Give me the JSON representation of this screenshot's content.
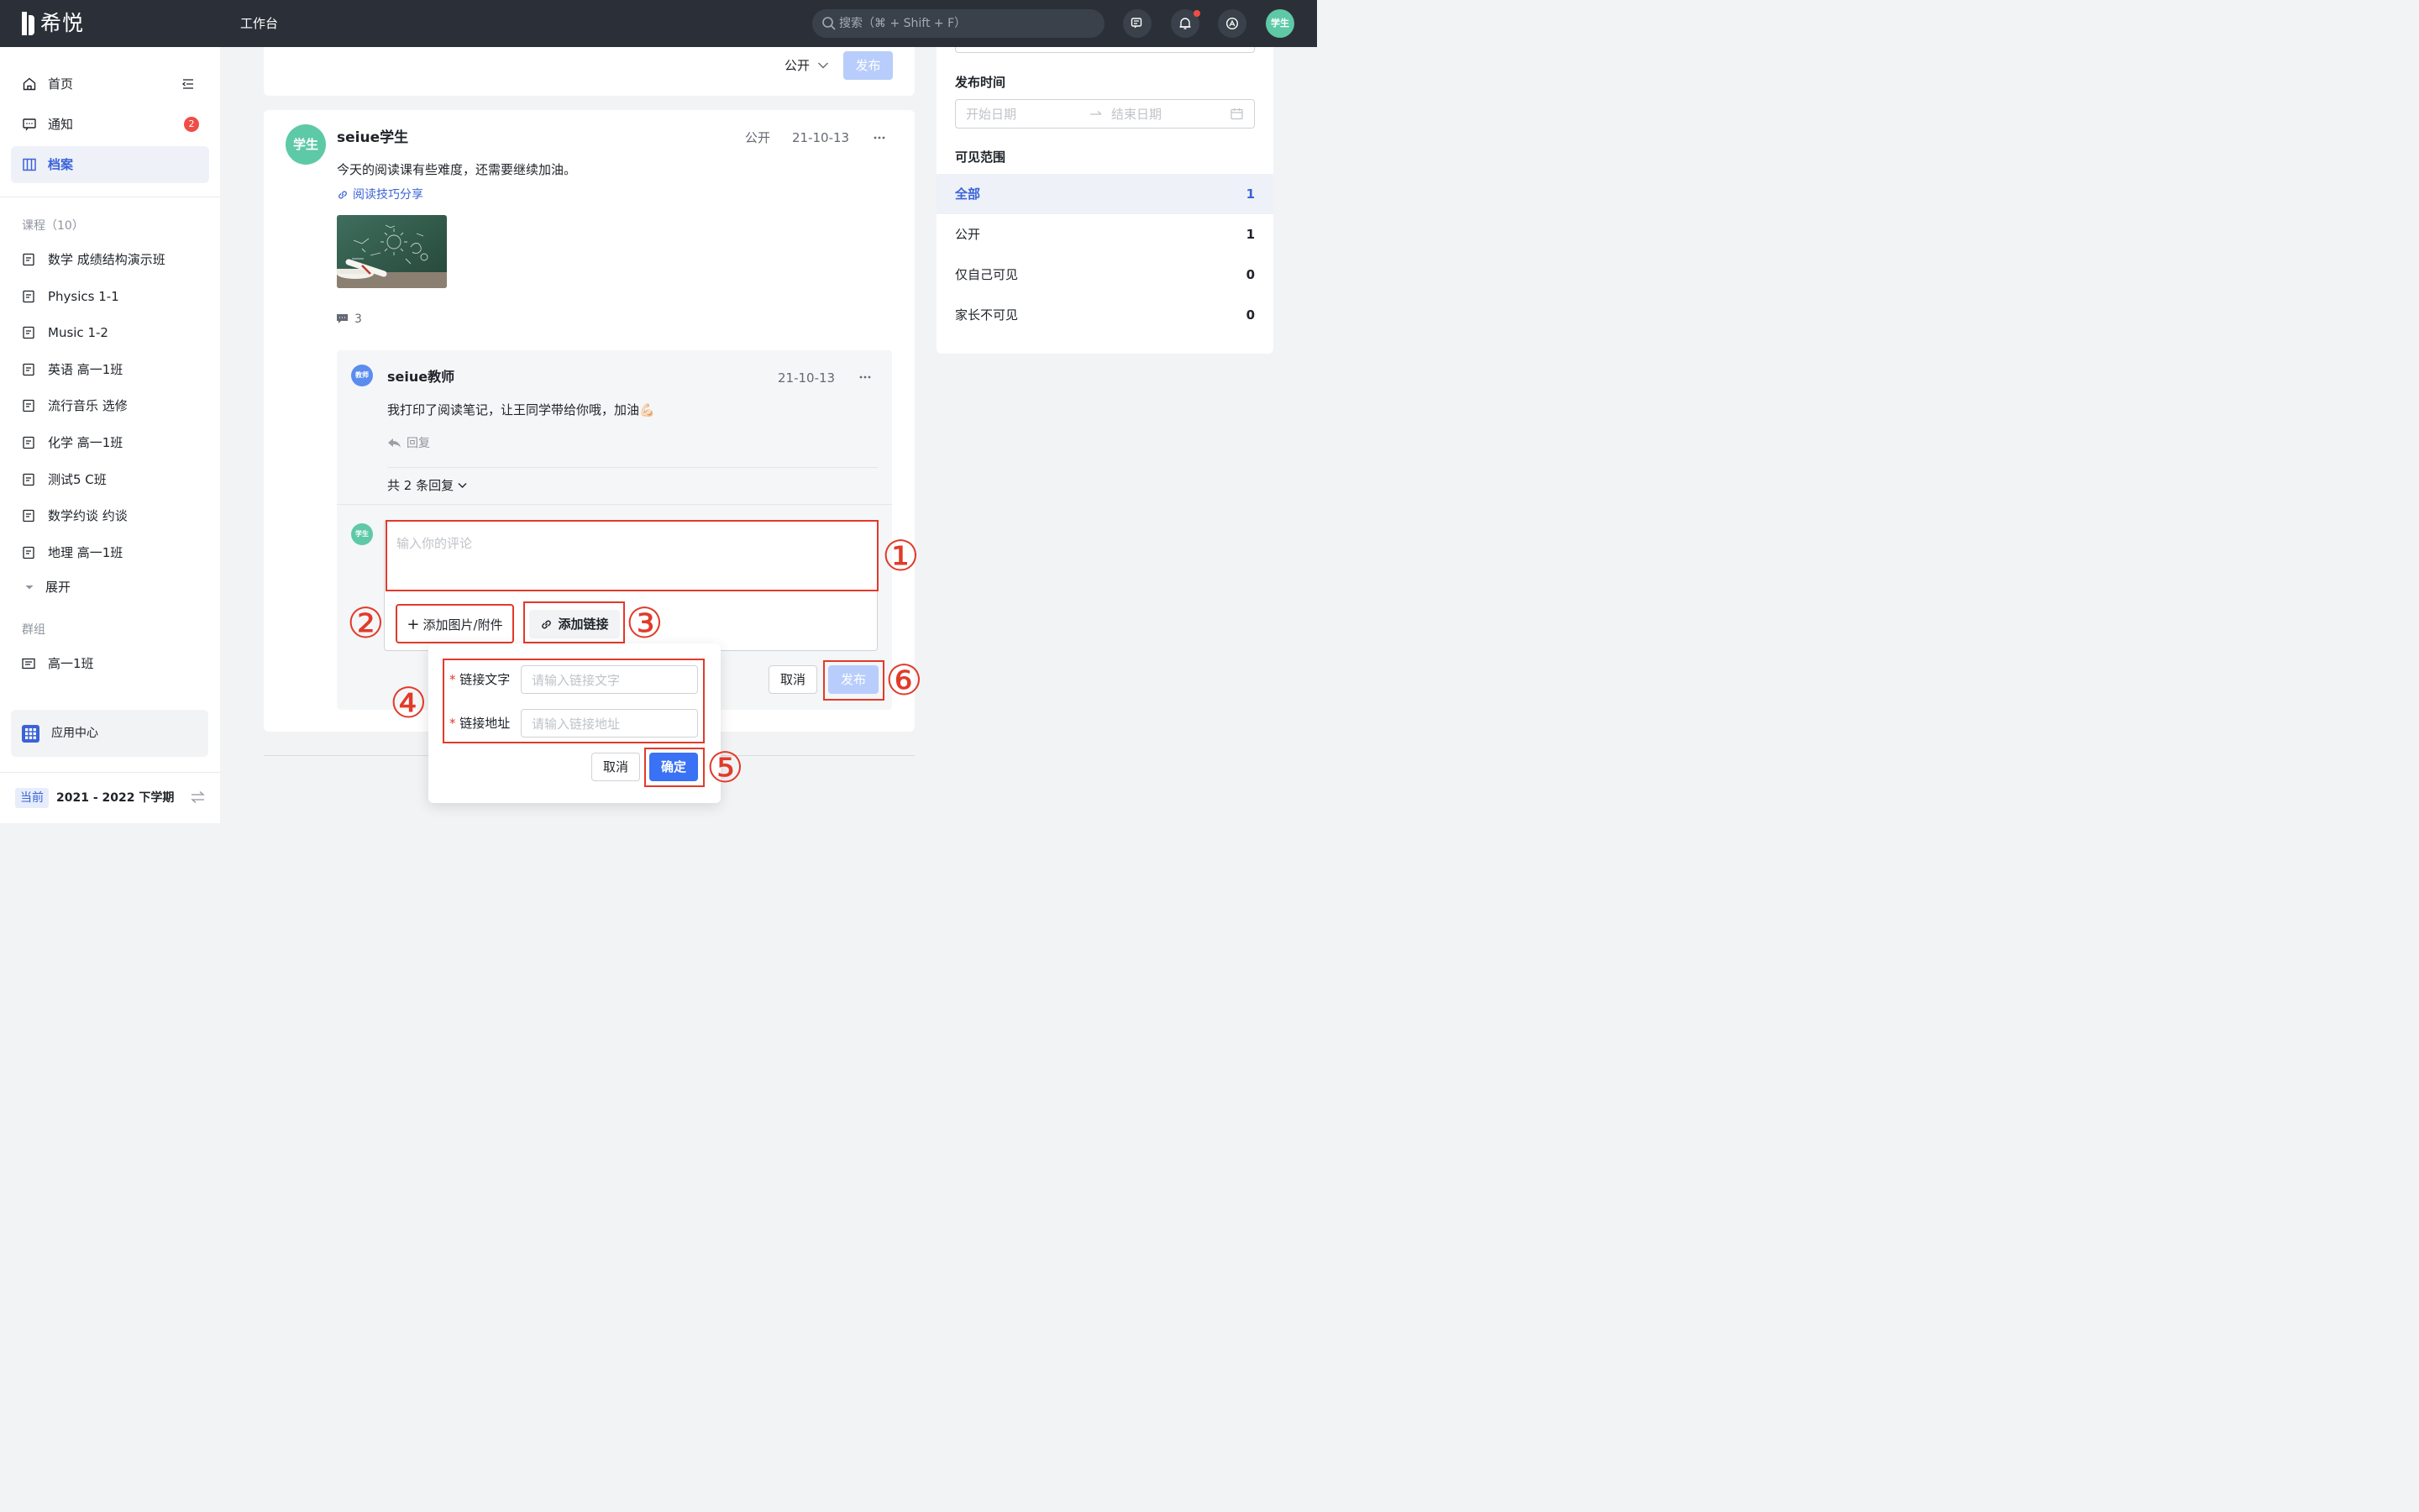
{
  "topbar": {
    "logo_text": "希悦",
    "workbench": "工作台",
    "search_placeholder": "搜索（⌘ + Shift + F）",
    "avatar": "学生"
  },
  "sidebar": {
    "nav": [
      {
        "label": "首页",
        "icon": "home-icon"
      },
      {
        "label": "通知",
        "icon": "message-icon",
        "badge": "2"
      },
      {
        "label": "档案",
        "icon": "archive-icon",
        "active": true
      }
    ],
    "courses_title": "课程（10）",
    "courses": [
      "数学 成绩结构演示班",
      "Physics 1-1",
      "Music 1-2",
      "英语 高一1班",
      "流行音乐 选修",
      "化学 高一1班",
      "测试5 C班",
      "数学约谈 约谈",
      "地理 高一1班"
    ],
    "expand_label": "展开",
    "groups_title": "群组",
    "groups": [
      "高一1班"
    ],
    "app_center": "应用中心",
    "term_tag": "当前",
    "term": "2021 - 2022 下学期"
  },
  "composer": {
    "visibility": "公开",
    "publish": "发布"
  },
  "post": {
    "avatar": "学生",
    "author": "seiue学生",
    "visibility": "公开",
    "date": "21-10-13",
    "content": "今天的阅读课有些难度，还需要继续加油。",
    "link_text": "阅读技巧分享",
    "comment_count": "3"
  },
  "comment": {
    "avatar": "教师",
    "author": "seiue教师",
    "date": "21-10-13",
    "content": "我打印了阅读笔记，让王同学带给你哦，加油💪🏻",
    "reply": "回复",
    "replies_summary": "共 2 条回复"
  },
  "comment_input": {
    "avatar": "学生",
    "placeholder": "输入你的评论",
    "add_attachment": "添加图片/附件",
    "add_link": "添加链接",
    "cancel": "取消",
    "publish": "发布"
  },
  "link_popover": {
    "text_label": "链接文字",
    "text_placeholder": "请输入链接文字",
    "url_label": "链接地址",
    "url_placeholder": "请输入链接地址",
    "cancel": "取消",
    "confirm": "确定"
  },
  "annotations": [
    "①",
    "②",
    "③",
    "④",
    "⑤",
    "⑥"
  ],
  "filter_panel": {
    "publish_time_title": "发布时间",
    "start_placeholder": "开始日期",
    "end_placeholder": "结束日期",
    "scope_title": "可见范围",
    "scopes": [
      {
        "label": "全部",
        "count": "1",
        "active": true
      },
      {
        "label": "公开",
        "count": "1"
      },
      {
        "label": "仅自己可见",
        "count": "0"
      },
      {
        "label": "家长不可见",
        "count": "0"
      }
    ]
  },
  "colors": {
    "primary": "#3a63d8",
    "annotation_red": "#e23a2a",
    "avatar_green": "#5ec9a6",
    "topbar": "#2b3038"
  }
}
